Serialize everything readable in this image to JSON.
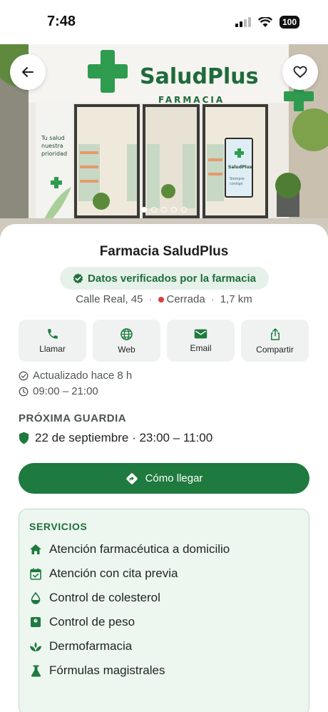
{
  "status_bar": {
    "time": "7:48",
    "battery": "100"
  },
  "hero": {
    "sign_name": "SaludPlus",
    "sign_sub": "FARMACIA",
    "poster_line1": "Tu salud",
    "poster_line2": "nuestra",
    "poster_line3": "prioridad",
    "screen_name": "SaludPlus",
    "screen_sub1": "Siempre",
    "screen_sub2": "contigo",
    "carousel_total": 5,
    "carousel_active": 1
  },
  "pharmacy": {
    "name": "Farmacia SaludPlus",
    "verified_label": "Datos verificados por la farmacia",
    "address": "Calle Real, 45",
    "status": "Cerrada",
    "distance": "1,7 km",
    "separator": "·"
  },
  "actions": [
    {
      "label": "Llamar",
      "icon": "phone-icon"
    },
    {
      "label": "Web",
      "icon": "globe-icon"
    },
    {
      "label": "Email",
      "icon": "email-icon"
    },
    {
      "label": "Compartir",
      "icon": "share-icon"
    }
  ],
  "info": {
    "updated": "Actualizado hace 8 h",
    "hours": "09:00 – 21:00"
  },
  "guard": {
    "title": "PRÓXIMA GUARDIA",
    "detail": "22 de septiembre · 23:00 – 11:00"
  },
  "cta": {
    "label": "Cómo llegar"
  },
  "services": {
    "title": "SERVICIOS",
    "items": [
      {
        "label": "Atención farmacéutica a domicilio",
        "icon": "home-icon"
      },
      {
        "label": "Atención con cita previa",
        "icon": "calendar-check-icon"
      },
      {
        "label": "Control de colesterol",
        "icon": "drop-icon"
      },
      {
        "label": "Control de peso",
        "icon": "scale-icon"
      },
      {
        "label": "Dermofarmacia",
        "icon": "spa-icon"
      },
      {
        "label": "Fórmulas magistrales",
        "icon": "flask-icon"
      }
    ]
  },
  "colors": {
    "brand": "#1e7a3e",
    "closed": "#d93d3d",
    "services_bg": "#eef6f0"
  }
}
